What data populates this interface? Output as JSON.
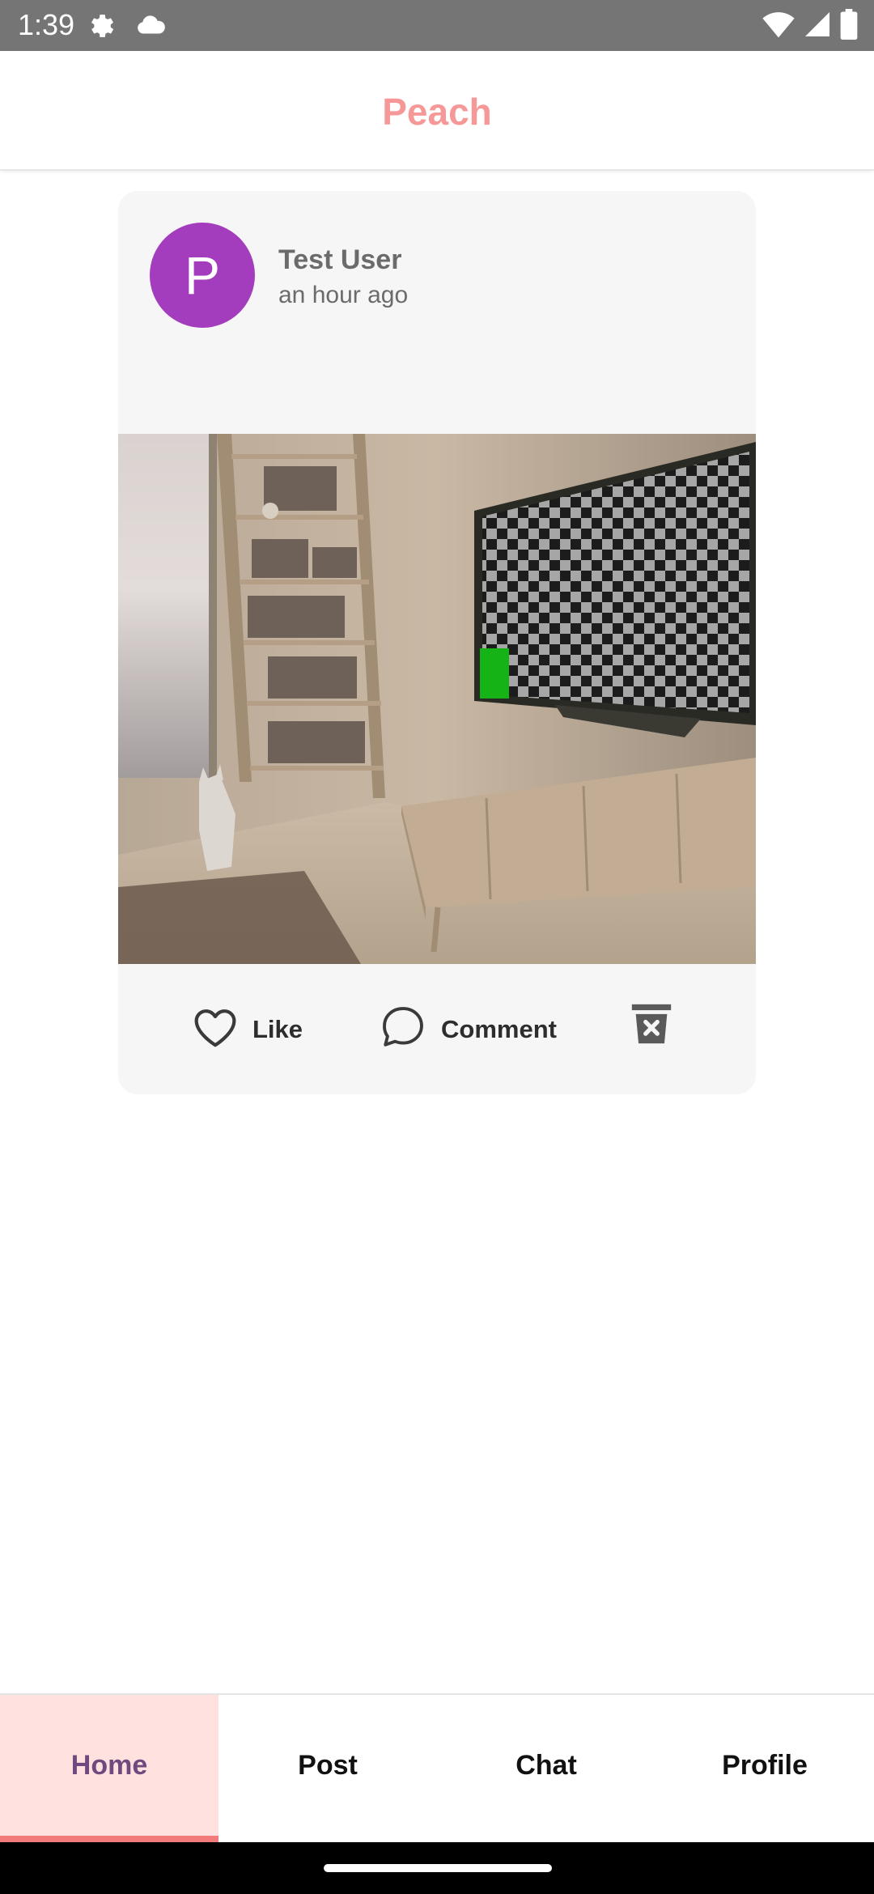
{
  "status_bar": {
    "time": "1:39",
    "left_icons": [
      "settings-icon",
      "cloud-icon"
    ],
    "right_icons": [
      "wifi-icon",
      "signal-icon",
      "battery-icon"
    ]
  },
  "app": {
    "title": "Peach",
    "brand_color": "#f79898"
  },
  "post": {
    "author_name": "Test User",
    "avatar_initial": "P",
    "avatar_color": "#a43cbe",
    "time": "an hour ago",
    "image": "photo of a room with a wooden bookshelf ladder, a cat figurine and a TV showing a checkerboard pattern",
    "actions": {
      "like_label": "Like",
      "comment_label": "Comment",
      "delete_icon": "delete-icon"
    }
  },
  "bottom_nav": {
    "items": [
      {
        "label": "Home",
        "active": true
      },
      {
        "label": "Post",
        "active": false
      },
      {
        "label": "Chat",
        "active": false
      },
      {
        "label": "Profile",
        "active": false
      }
    ],
    "active_color": "#6f4a7e",
    "active_background": "#ffe1df",
    "indicator_color": "#f17a7a"
  }
}
